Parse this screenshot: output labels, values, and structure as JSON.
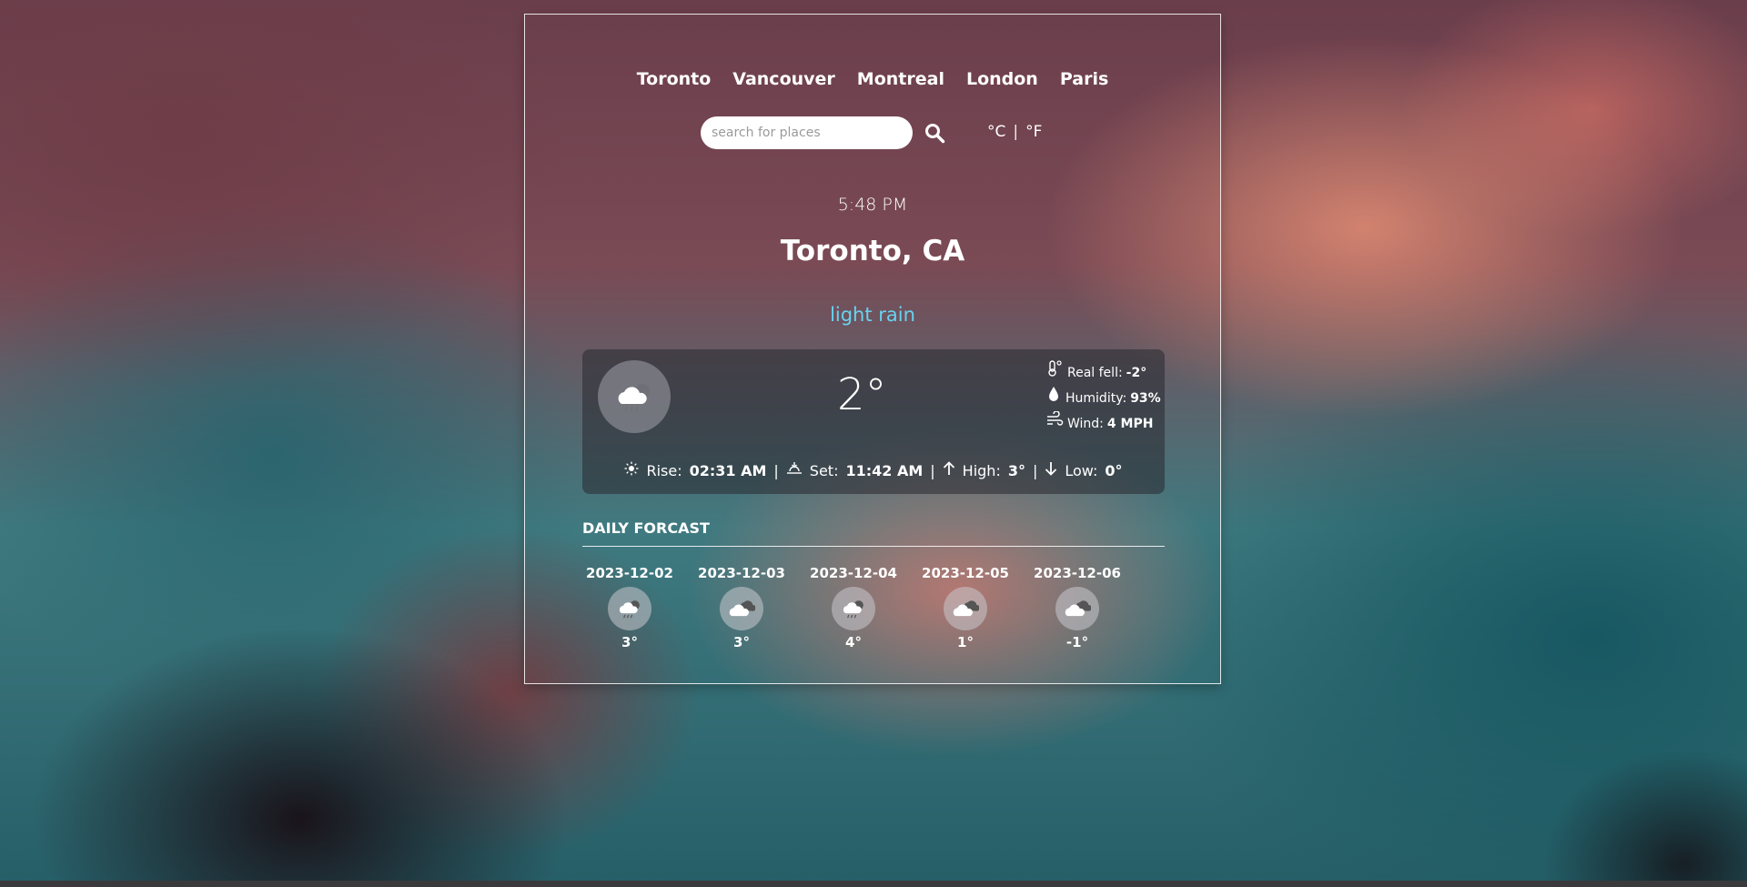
{
  "cities": [
    "Toronto",
    "Vancouver",
    "Montreal",
    "London",
    "Paris"
  ],
  "search": {
    "placeholder": "search for places"
  },
  "units": {
    "celsius": "°C",
    "separator": "|",
    "fahrenheit": "°F"
  },
  "current": {
    "time": "5:48 PM",
    "location": "Toronto, CA",
    "condition": "light rain",
    "condition_color": "#67d3f0",
    "icon": "rain-cloud-icon",
    "temperature": "2°",
    "real_feel_label": "Real fell:",
    "real_feel": "-2°",
    "humidity_label": "Humidity:",
    "humidity": "93%",
    "wind_label": "Wind:",
    "wind": "4 MPH",
    "rise_label": "Rise:",
    "rise": "02:31 AM",
    "set_label": "Set:",
    "set": "11:42 AM",
    "high_label": "High:",
    "high": "3°",
    "low_label": "Low:",
    "low": "0°",
    "separator": "|"
  },
  "forecast": {
    "title": "DAILY FORCAST",
    "days": [
      {
        "date": "2023-12-02",
        "icon": "rain-cloud-icon",
        "temp": "3°"
      },
      {
        "date": "2023-12-03",
        "icon": "cloudy-icon",
        "temp": "3°"
      },
      {
        "date": "2023-12-04",
        "icon": "rain-cloud-icon",
        "temp": "4°"
      },
      {
        "date": "2023-12-05",
        "icon": "cloudy-icon",
        "temp": "1°"
      },
      {
        "date": "2023-12-06",
        "icon": "cloudy-icon",
        "temp": "-1°"
      }
    ]
  }
}
